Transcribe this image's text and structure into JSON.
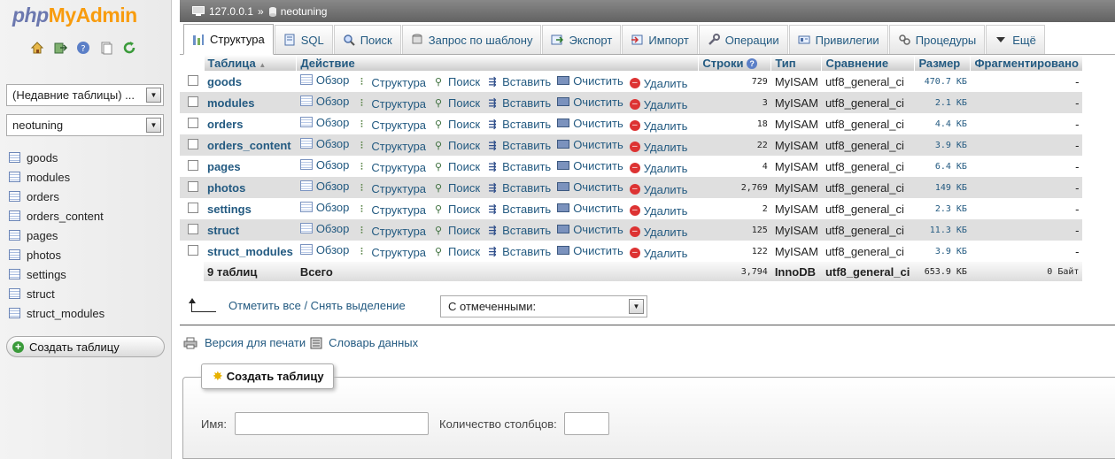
{
  "logo": {
    "php": "php",
    "my": "My",
    "admin": "Admin"
  },
  "left": {
    "nav_icons": [
      "home-icon",
      "exit-icon",
      "help-icon",
      "docs-icon",
      "reload-icon"
    ],
    "recent_tables": "(Недавние таблицы) ...",
    "database_select": "neotuning",
    "tables": [
      "goods",
      "modules",
      "orders",
      "orders_content",
      "pages",
      "photos",
      "settings",
      "struct",
      "struct_modules"
    ],
    "create_table": "Создать таблицу"
  },
  "breadcrumb": {
    "server": "127.0.0.1",
    "separator": "»",
    "database": "neotuning"
  },
  "tabs": [
    {
      "label": "Структура",
      "icon": "structure-icon"
    },
    {
      "label": "SQL",
      "icon": "sql-icon"
    },
    {
      "label": "Поиск",
      "icon": "search-icon"
    },
    {
      "label": "Запрос по шаблону",
      "icon": "query-icon"
    },
    {
      "label": "Экспорт",
      "icon": "export-icon"
    },
    {
      "label": "Импорт",
      "icon": "import-icon"
    },
    {
      "label": "Операции",
      "icon": "wrench-icon"
    },
    {
      "label": "Привилегии",
      "icon": "privileges-icon"
    },
    {
      "label": "Процедуры",
      "icon": "routines-icon"
    },
    {
      "label": "Ещё",
      "icon": "triangle-down-icon"
    }
  ],
  "table_headers": {
    "table": "Таблица",
    "sort": "▲",
    "action": "Действие",
    "rows": "Строки",
    "type": "Тип",
    "collation": "Сравнение",
    "size": "Размер",
    "overhead": "Фрагментировано"
  },
  "actions": {
    "browse": "Обзор",
    "structure": "Структура",
    "search": "Поиск",
    "insert": "Вставить",
    "empty": "Очистить",
    "drop": "Удалить"
  },
  "rows": [
    {
      "name": "goods",
      "rows": "729",
      "type": "MyISAM",
      "collation": "utf8_general_ci",
      "size": "470.7 КБ",
      "overhead": "-"
    },
    {
      "name": "modules",
      "rows": "3",
      "type": "MyISAM",
      "collation": "utf8_general_ci",
      "size": "2.1 КБ",
      "overhead": "-"
    },
    {
      "name": "orders",
      "rows": "18",
      "type": "MyISAM",
      "collation": "utf8_general_ci",
      "size": "4.4 КБ",
      "overhead": "-"
    },
    {
      "name": "orders_content",
      "rows": "22",
      "type": "MyISAM",
      "collation": "utf8_general_ci",
      "size": "3.9 КБ",
      "overhead": "-"
    },
    {
      "name": "pages",
      "rows": "4",
      "type": "MyISAM",
      "collation": "utf8_general_ci",
      "size": "6.4 КБ",
      "overhead": "-"
    },
    {
      "name": "photos",
      "rows": "2,769",
      "type": "MyISAM",
      "collation": "utf8_general_ci",
      "size": "149 КБ",
      "overhead": "-"
    },
    {
      "name": "settings",
      "rows": "2",
      "type": "MyISAM",
      "collation": "utf8_general_ci",
      "size": "2.3 КБ",
      "overhead": "-"
    },
    {
      "name": "struct",
      "rows": "125",
      "type": "MyISAM",
      "collation": "utf8_general_ci",
      "size": "11.3 КБ",
      "overhead": "-"
    },
    {
      "name": "struct_modules",
      "rows": "122",
      "type": "MyISAM",
      "collation": "utf8_general_ci",
      "size": "3.9 КБ",
      "overhead": "-"
    }
  ],
  "total": {
    "count": "9 таблиц",
    "label": "Всего",
    "rows": "3,794",
    "type": "InnoDB",
    "collation": "utf8_general_ci",
    "size": "653.9 КБ",
    "overhead": "0 Байт"
  },
  "bottom": {
    "check_all": "Отметить все / Снять выделение",
    "with_selected": "С отмеченными:",
    "print_view": "Версия для печати",
    "data_dictionary": "Словарь данных"
  },
  "create_form": {
    "legend": "Создать таблицу",
    "name_label": "Имя:",
    "name_value": "",
    "columns_label": "Количество столбцов:",
    "columns_value": ""
  }
}
